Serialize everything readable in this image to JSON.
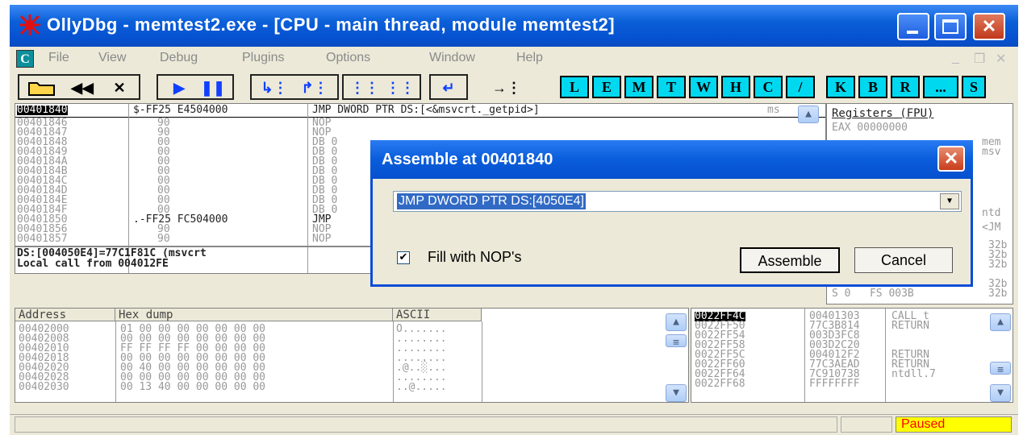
{
  "window": {
    "title": "OllyDbg - memtest2.exe - [CPU - main thread, module memtest2]"
  },
  "menu": {
    "items": [
      "File",
      "View",
      "Debug",
      "Plugins",
      "Options",
      "Window",
      "Help"
    ],
    "mdi_icon": "C"
  },
  "toolbar": {
    "letter_buttons": [
      "L",
      "E",
      "M",
      "T",
      "W",
      "H",
      "C",
      "/",
      "K",
      "B",
      "R",
      "...",
      "S"
    ]
  },
  "disasm": {
    "selected": {
      "addr": "00401840",
      "hex": "$-FF25 E4504000",
      "cmd": "JMP DWORD PTR DS:[<&msvcrt._getpid>]",
      "comment": "ms"
    },
    "rows": [
      {
        "addr": "00401846",
        "hex": "90",
        "cmd": "NOP"
      },
      {
        "addr": "00401847",
        "hex": "90",
        "cmd": "NOP"
      },
      {
        "addr": "00401848",
        "hex": "00",
        "cmd": "DB 0"
      },
      {
        "addr": "00401849",
        "hex": "00",
        "cmd": "DB 0"
      },
      {
        "addr": "0040184A",
        "hex": "00",
        "cmd": "DB 0"
      },
      {
        "addr": "0040184B",
        "hex": "00",
        "cmd": "DB 0"
      },
      {
        "addr": "0040184C",
        "hex": "00",
        "cmd": "DB 0"
      },
      {
        "addr": "0040184D",
        "hex": "00",
        "cmd": "DB 0"
      },
      {
        "addr": "0040184E",
        "hex": "00",
        "cmd": "DB 0"
      },
      {
        "addr": "0040184F",
        "hex": "00",
        "cmd": "DB 0"
      },
      {
        "addr": "00401850",
        "hex": ".-FF25 FC504000",
        "cmd": "JMP"
      },
      {
        "addr": "00401856",
        "hex": "90",
        "cmd": "NOP"
      },
      {
        "addr": "00401857",
        "hex": "90",
        "cmd": "NOP"
      }
    ],
    "info_line1": "DS:[004050E4]=77C1F81C (msvcrt",
    "info_line2": "Local call from 004012FE"
  },
  "registers": {
    "header": "Registers (FPU)",
    "eax": "EAX 00000000",
    "side": [
      "mem",
      "msv",
      "ntd",
      "<JM",
      "32b",
      "32b",
      "32b",
      "32b",
      "32b"
    ],
    "seg1": "S 0   FS 003B"
  },
  "dump": {
    "headers": {
      "address": "Address",
      "hex": "Hex dump",
      "ascii": "ASCII"
    },
    "rows": [
      {
        "addr": "00402000",
        "hex": "01 00 00 00 00 00 00 00",
        "ascii": "O......."
      },
      {
        "addr": "00402008",
        "hex": "00 00 00 00 00 00 00 00",
        "ascii": "........"
      },
      {
        "addr": "00402010",
        "hex": "FF FF FF FF 00 00 00 00",
        "ascii": "........"
      },
      {
        "addr": "00402018",
        "hex": "00 00 00 00 00 00 00 00",
        "ascii": "........"
      },
      {
        "addr": "00402020",
        "hex": "00 40 00 00 00 00 00 00",
        "ascii": ".@..░..."
      },
      {
        "addr": "00402028",
        "hex": "00 00 00 00 00 00 00 00",
        "ascii": "........"
      },
      {
        "addr": "00402030",
        "hex": "00 13 40 00 00 00 00 00",
        "ascii": "..@....."
      }
    ]
  },
  "stack": {
    "selected": {
      "addr": "0022FF4C",
      "val": "00401303",
      "comment": "CALL t"
    },
    "rows": [
      {
        "addr": "0022FF50",
        "val": "77C3B814",
        "comment": "RETURN"
      },
      {
        "addr": "0022FF54",
        "val": "003D3FC8",
        "comment": ""
      },
      {
        "addr": "0022FF58",
        "val": "003D2C20",
        "comment": ""
      },
      {
        "addr": "0022FF5C",
        "val": "004012F2",
        "comment": "RETURN"
      },
      {
        "addr": "0022FF60",
        "val": "77C3AEAD",
        "comment": "RETURN"
      },
      {
        "addr": "0022FF64",
        "val": "7C910738",
        "comment": "ntdll.7"
      },
      {
        "addr": "0022FF68",
        "val": "FFFFFFFF",
        "comment": ""
      }
    ]
  },
  "status": {
    "state": "Paused"
  },
  "dialog": {
    "title": "Assemble at 00401840",
    "command": "JMP DWORD PTR DS:[4050E4]",
    "fill_nops_label": "Fill with NOP's",
    "fill_nops_checked": true,
    "assemble_label": "Assemble",
    "cancel_label": "Cancel"
  },
  "colors": {
    "titlebar": "#0a5fd8",
    "letter_buttons": "#00d8f0",
    "paused_bg": "#ffff00",
    "paused_text": "#ff0000"
  }
}
